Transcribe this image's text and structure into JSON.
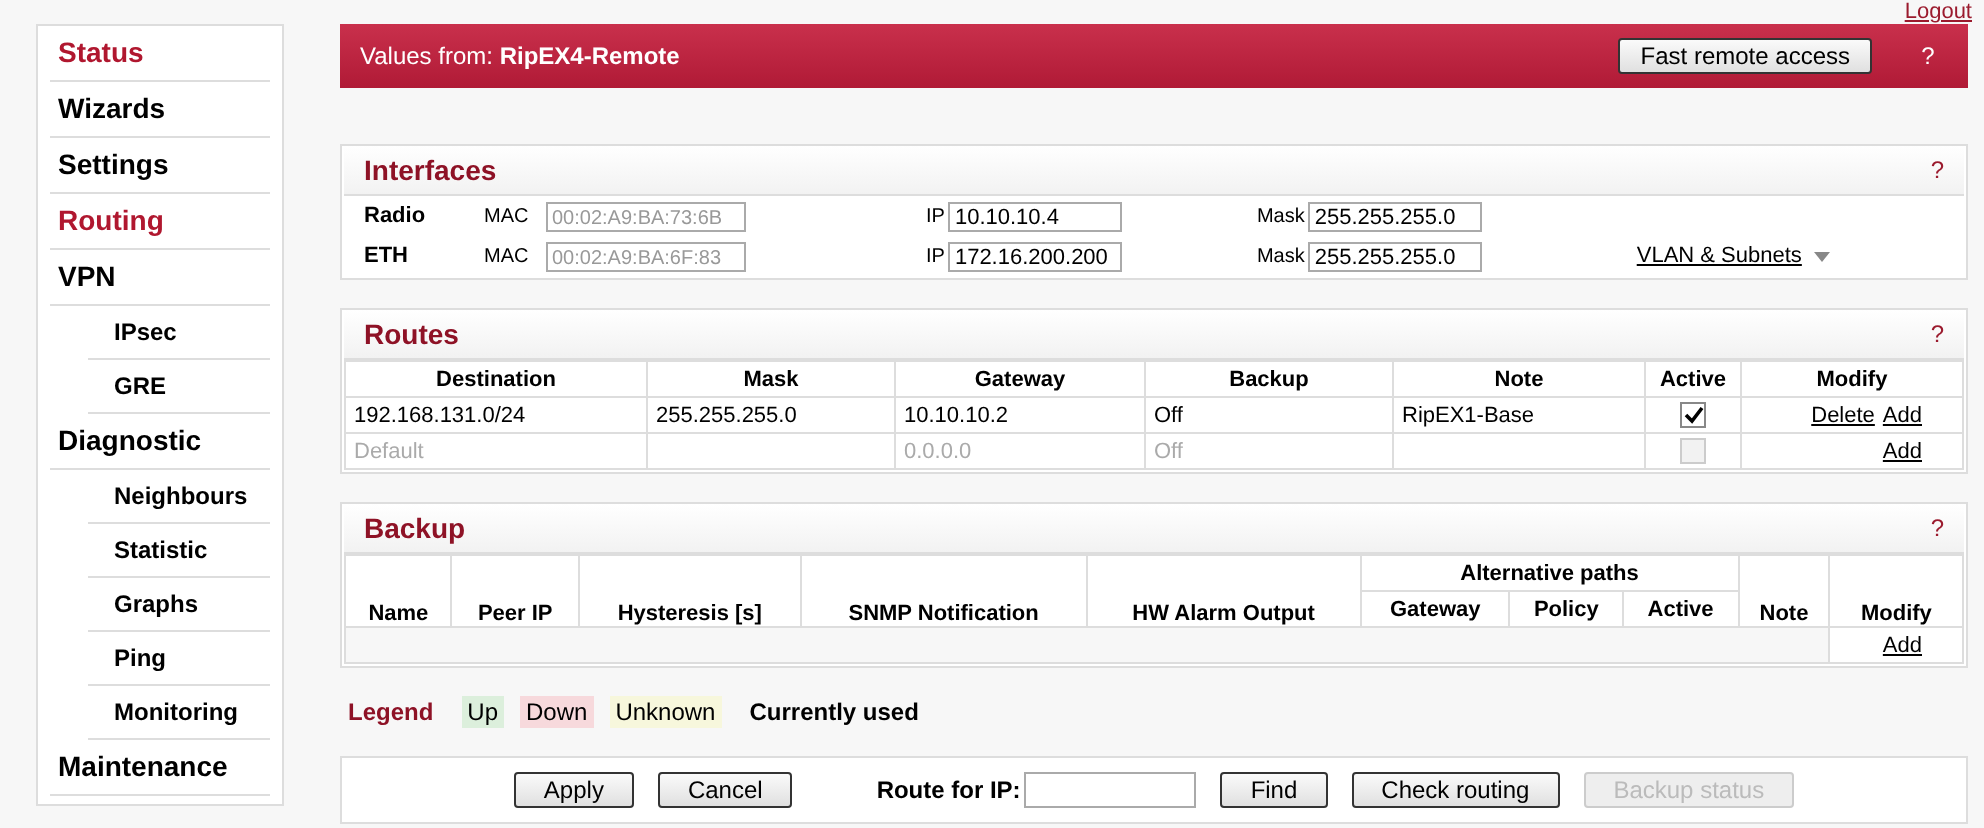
{
  "top_link": "Logout",
  "sidebar": {
    "items": [
      {
        "label": "Status",
        "highlighted": true
      },
      {
        "label": "Wizards",
        "highlighted": false
      },
      {
        "label": "Settings",
        "highlighted": false
      },
      {
        "label": "Routing",
        "highlighted": true
      },
      {
        "label": "VPN",
        "highlighted": false,
        "children": [
          {
            "label": "IPsec"
          },
          {
            "label": "GRE"
          }
        ]
      },
      {
        "label": "Diagnostic",
        "highlighted": false,
        "children": [
          {
            "label": "Neighbours"
          },
          {
            "label": "Statistic"
          },
          {
            "label": "Graphs"
          },
          {
            "label": "Ping"
          },
          {
            "label": "Monitoring"
          }
        ]
      },
      {
        "label": "Maintenance",
        "highlighted": false
      }
    ]
  },
  "header": {
    "prefix": "Values from:",
    "device": "RipEX4-Remote",
    "button": "Fast remote access",
    "help": "?"
  },
  "interfaces": {
    "title": "Interfaces",
    "help": "?",
    "link": "VLAN & Subnets",
    "rows": [
      {
        "name": "Radio",
        "mac_label": "MAC",
        "mac": "00:02:A9:BA:73:6B",
        "ip_label": "IP",
        "ip": "10.10.10.4",
        "mask_label": "Mask",
        "mask": "255.255.255.0"
      },
      {
        "name": "ETH",
        "mac_label": "MAC",
        "mac": "00:02:A9:BA:6F:83",
        "ip_label": "IP",
        "ip": "172.16.200.200",
        "mask_label": "Mask",
        "mask": "255.255.255.0"
      }
    ]
  },
  "routes": {
    "title": "Routes",
    "help": "?",
    "columns": [
      "Destination",
      "Mask",
      "Gateway",
      "Backup",
      "Note",
      "Active",
      "Modify"
    ],
    "rows": [
      {
        "disabled": false,
        "destination": "192.168.131.0/24",
        "mask": "255.255.255.0",
        "gateway": "10.10.10.2",
        "backup": "Off",
        "note": "RipEX1-Base",
        "active": true,
        "actions": [
          "Delete",
          "Add"
        ]
      },
      {
        "disabled": true,
        "destination": "Default",
        "mask": "",
        "gateway": "0.0.0.0",
        "backup": "Off",
        "note": "",
        "active": false,
        "actions": [
          "Add"
        ]
      }
    ]
  },
  "backup": {
    "title": "Backup",
    "help": "?",
    "columns": [
      "Name",
      "Peer IP",
      "Hysteresis [s]",
      "SNMP Notification",
      "HW Alarm Output"
    ],
    "group": "Alternative paths",
    "group_columns": [
      "Gateway",
      "Policy",
      "Active"
    ],
    "tail_columns": [
      "Note",
      "Modify"
    ],
    "add": "Add"
  },
  "legend": {
    "title": "Legend",
    "items": [
      {
        "label": "Up",
        "color": "#dcefdc"
      },
      {
        "label": "Down",
        "color": "#f7d9dc"
      },
      {
        "label": "Unknown",
        "color": "#f7f7dc"
      }
    ],
    "current": "Currently used"
  },
  "footer": {
    "buttons": [
      {
        "label": "Apply",
        "disabled": false
      },
      {
        "label": "Cancel",
        "disabled": false
      }
    ],
    "route_label": "Route for IP:",
    "route_buttons": [
      {
        "label": "Find",
        "disabled": false
      },
      {
        "label": "Check routing",
        "disabled": false
      },
      {
        "label": "Backup status",
        "disabled": true
      }
    ]
  }
}
